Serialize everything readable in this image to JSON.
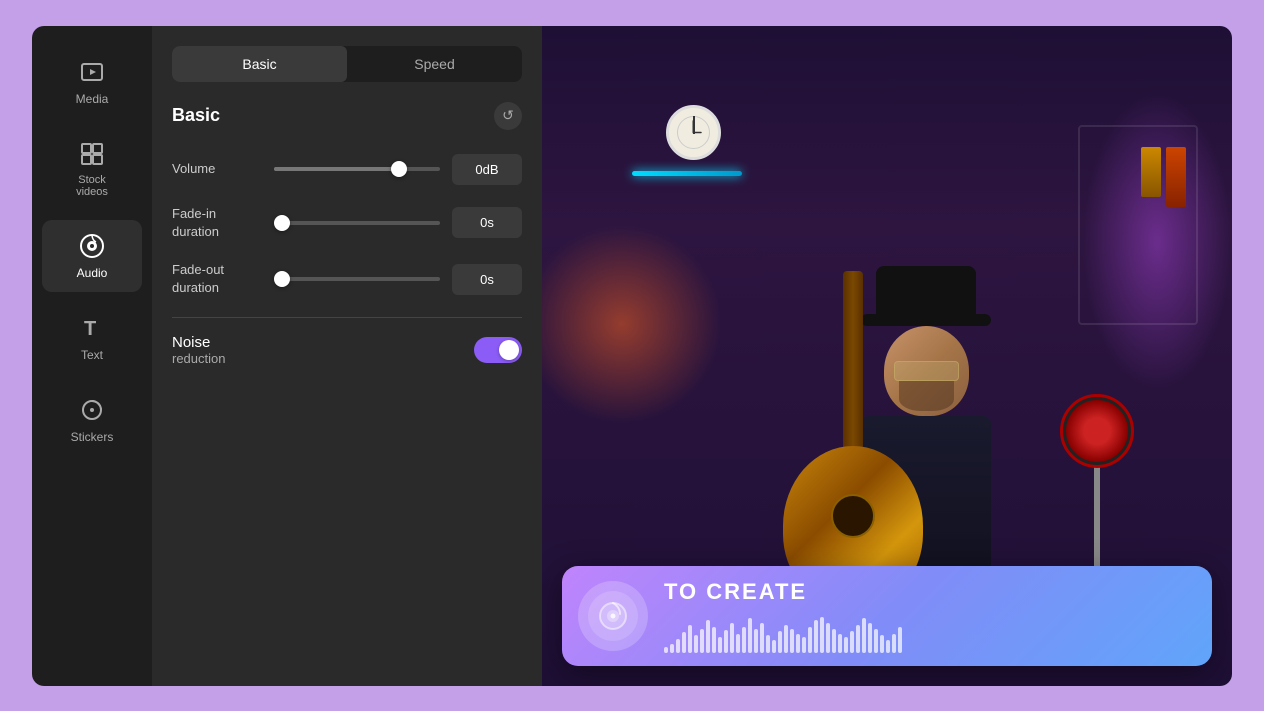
{
  "sidebar": {
    "items": [
      {
        "id": "media",
        "label": "Media",
        "icon": "▶",
        "active": false
      },
      {
        "id": "stock-videos",
        "label": "Stock\nvideos",
        "icon": "⊞",
        "active": false
      },
      {
        "id": "audio",
        "label": "Audio",
        "icon": "♪",
        "active": true
      },
      {
        "id": "text",
        "label": "Text",
        "icon": "T",
        "active": false
      },
      {
        "id": "stickers",
        "label": "Stickers",
        "icon": "◷",
        "active": false
      }
    ]
  },
  "audio_panel": {
    "tabs": [
      {
        "id": "basic",
        "label": "Basic",
        "active": true
      },
      {
        "id": "speed",
        "label": "Speed",
        "active": false
      }
    ],
    "section_title": "Basic",
    "reset_tooltip": "Reset",
    "controls": [
      {
        "id": "volume",
        "label": "Volume",
        "value": "0dB",
        "slider_percent": 75
      },
      {
        "id": "fade_in",
        "label": "Fade-in\nduration",
        "value": "0s",
        "slider_percent": 5
      },
      {
        "id": "fade_out",
        "label": "Fade-out\nduration",
        "value": "0s",
        "slider_percent": 5
      }
    ],
    "noise_section": {
      "title": "Noise",
      "subtitle": "reduction",
      "toggle_on": true
    }
  },
  "audio_card": {
    "label": "TO CREATE",
    "waveform_bars": [
      6,
      10,
      16,
      24,
      32,
      20,
      28,
      38,
      30,
      18,
      26,
      35,
      22,
      30,
      40,
      28,
      35,
      20,
      15,
      25,
      32,
      28,
      22,
      18,
      30,
      38,
      42,
      35,
      28,
      22,
      18,
      25,
      32,
      40,
      35,
      28,
      20,
      15,
      22,
      30
    ]
  }
}
